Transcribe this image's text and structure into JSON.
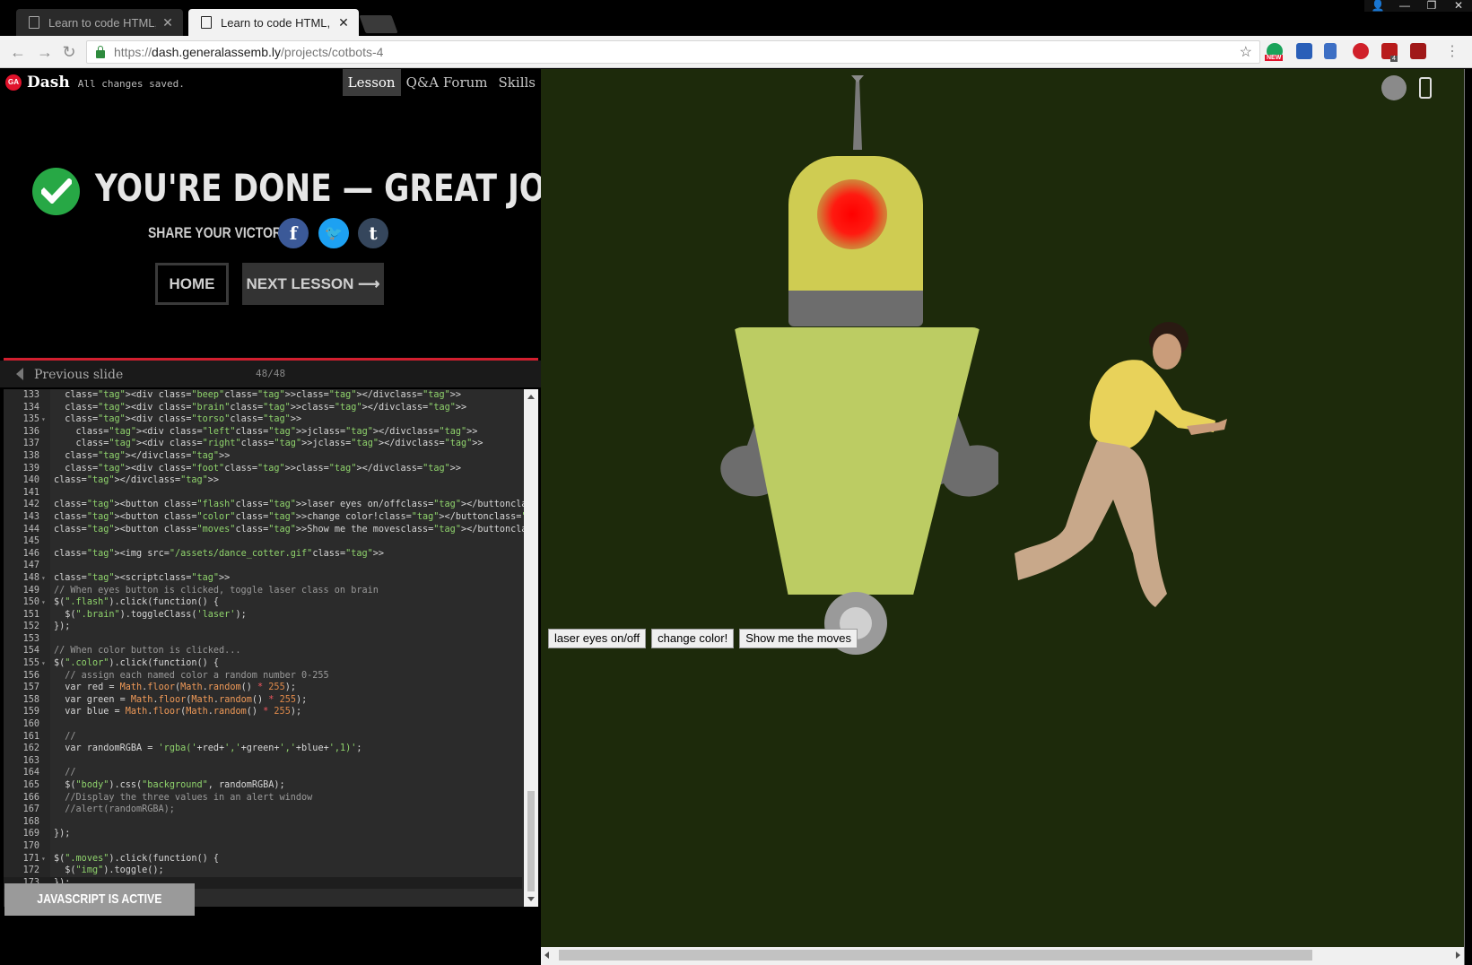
{
  "browser": {
    "tabs": [
      {
        "title": "Learn to code HTML, CSS",
        "active": false
      },
      {
        "title": "Learn to code HTML, CSS",
        "active": true
      }
    ],
    "url": {
      "scheme": "https://",
      "host": "dash.generalassemb.ly",
      "path": "/projects/cotbots-4"
    },
    "extensions": [
      "grammarly-icon",
      "bookmark-icon",
      "books-icon",
      "adblock-icon",
      "ublock-icon",
      "red-extension-icon"
    ],
    "extension_badges": {
      "new": "NEW",
      "ublock_count": "4"
    }
  },
  "dash": {
    "logo": "GA",
    "brand": "Dash",
    "status": "All changes saved.",
    "nav": [
      {
        "label": "Lesson",
        "active": true
      },
      {
        "label": "Q&A Forum",
        "active": false
      },
      {
        "label": "Skills",
        "active": false
      }
    ]
  },
  "completion": {
    "title": "YOU'RE DONE — GREAT JOB!",
    "share_label": "SHARE YOUR VICTORY:",
    "share": [
      {
        "network": "facebook",
        "glyph": "f",
        "color": "#3b5998"
      },
      {
        "network": "twitter",
        "glyph": "🐦",
        "color": "#1da1f2"
      },
      {
        "network": "tumblr",
        "glyph": "t",
        "color": "#35465c"
      }
    ],
    "home_label": "HOME",
    "next_label": "NEXT LESSON ⟶"
  },
  "slides": {
    "prev_label": "Previous slide",
    "counter": "48/48",
    "current": 48,
    "total": 48
  },
  "editor": {
    "lines": [
      {
        "n": "133",
        "code": "  <div class=\"beep\"></div>"
      },
      {
        "n": "134",
        "code": "  <div class=\"brain\"></div>"
      },
      {
        "n": "135",
        "code": "  <div class=\"torso\">",
        "fold": true
      },
      {
        "n": "136",
        "code": "    <div class=\"left\">j</div>"
      },
      {
        "n": "137",
        "code": "    <div class=\"right\">j</div>"
      },
      {
        "n": "138",
        "code": "  </div>"
      },
      {
        "n": "139",
        "code": "  <div class=\"foot\"></div>"
      },
      {
        "n": "140",
        "code": "</div>"
      },
      {
        "n": "141",
        "code": ""
      },
      {
        "n": "142",
        "code": "<button class=\"flash\">laser eyes on/off</button>"
      },
      {
        "n": "143",
        "code": "<button class=\"color\">change color!</button>"
      },
      {
        "n": "144",
        "code": "<button class=\"moves\">Show me the moves</button>"
      },
      {
        "n": "145",
        "code": ""
      },
      {
        "n": "146",
        "code": "<img src=\"/assets/dance_cotter.gif\">"
      },
      {
        "n": "147",
        "code": ""
      },
      {
        "n": "148",
        "code": "<script>",
        "fold": true
      },
      {
        "n": "149",
        "code": "// When eyes button is clicked, toggle laser class on brain"
      },
      {
        "n": "150",
        "code": "$(\".flash\").click(function() {",
        "fold": true
      },
      {
        "n": "151",
        "code": "  $(\".brain\").toggleClass('laser');"
      },
      {
        "n": "152",
        "code": "});"
      },
      {
        "n": "153",
        "code": ""
      },
      {
        "n": "154",
        "code": "// When color button is clicked..."
      },
      {
        "n": "155",
        "code": "$(\".color\").click(function() {",
        "fold": true
      },
      {
        "n": "156",
        "code": "  // assign each named color a random number 0-255"
      },
      {
        "n": "157",
        "code": "  var red = Math.floor(Math.random() * 255);"
      },
      {
        "n": "158",
        "code": "  var green = Math.floor(Math.random() * 255);"
      },
      {
        "n": "159",
        "code": "  var blue = Math.floor(Math.random() * 255);"
      },
      {
        "n": "160",
        "code": ""
      },
      {
        "n": "161",
        "code": "  //"
      },
      {
        "n": "162",
        "code": "  var randomRGBA = 'rgba('+red+','+green+','+blue+',1)';"
      },
      {
        "n": "163",
        "code": ""
      },
      {
        "n": "164",
        "code": "  //"
      },
      {
        "n": "165",
        "code": "  $(\"body\").css(\"background\", randomRGBA);"
      },
      {
        "n": "166",
        "code": "  //Display the three values in an alert window"
      },
      {
        "n": "167",
        "code": "  //alert(randomRGBA);"
      },
      {
        "n": "168",
        "code": ""
      },
      {
        "n": "169",
        "code": "});"
      },
      {
        "n": "170",
        "code": ""
      },
      {
        "n": "171",
        "code": "$(\".moves\").click(function() {",
        "fold": true
      },
      {
        "n": "172",
        "code": "  $(\"img\").toggle();"
      },
      {
        "n": "173",
        "code": "});",
        "current": true
      }
    ]
  },
  "js_status": "JAVASCRIPT IS ACTIVE",
  "preview": {
    "background": "#1d2a0b",
    "robot_colors": {
      "head": "#cfcc52",
      "torso": "#bccc63",
      "metal": "#6d6d6d",
      "eye": "#ff0000"
    },
    "buttons": [
      "laser eyes on/off",
      "change color!",
      "Show me the moves"
    ]
  }
}
